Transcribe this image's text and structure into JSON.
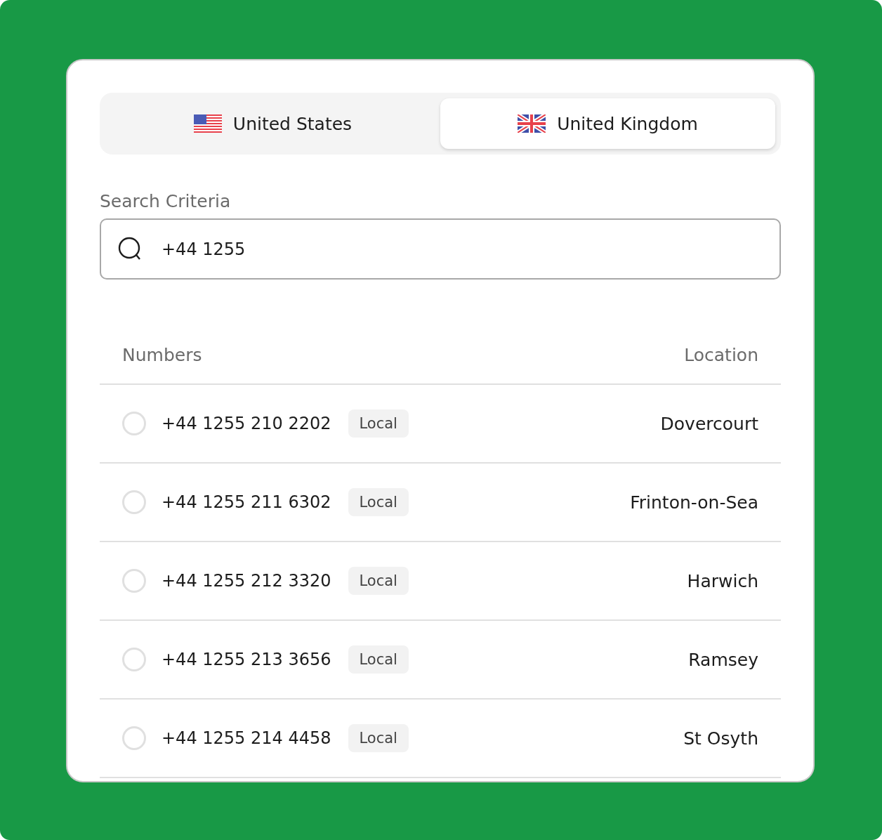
{
  "tabs": [
    {
      "label": "United States",
      "kind": "us",
      "selected": false
    },
    {
      "label": "United Kingdom",
      "kind": "uk",
      "selected": true
    }
  ],
  "search": {
    "label": "Search Criteria",
    "value": "+44 1255"
  },
  "table": {
    "columns": [
      "Numbers",
      "Location"
    ],
    "rows": [
      {
        "number": "+44 1255 210 2202",
        "tag": "Local",
        "location": "Dovercourt",
        "selected": false
      },
      {
        "number": "+44 1255 211 6302",
        "tag": "Local",
        "location": "Frinton-on-Sea",
        "selected": false
      },
      {
        "number": "+44 1255 212 3320",
        "tag": "Local",
        "location": "Harwich",
        "selected": false
      },
      {
        "number": "+44 1255 213 3656",
        "tag": "Local",
        "location": "Ramsey",
        "selected": false
      },
      {
        "number": "+44 1255 214 4458",
        "tag": "Local",
        "location": "St Osyth",
        "selected": false
      }
    ]
  }
}
